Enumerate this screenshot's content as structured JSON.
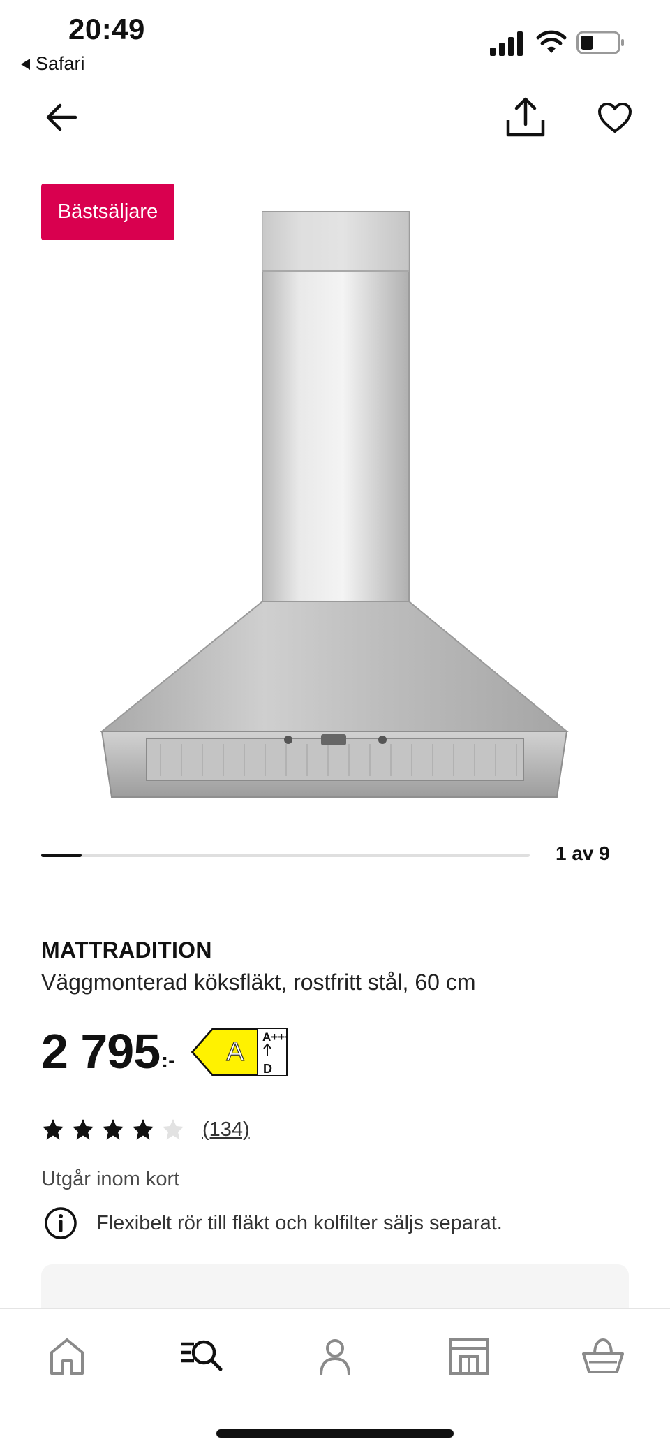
{
  "status_bar": {
    "time": "20:49",
    "back_app": "Safari"
  },
  "badge": {
    "label": "Bästsäljare",
    "color": "#d9004f"
  },
  "gallery": {
    "counter": "1 av 9",
    "progress": 0.083
  },
  "product": {
    "name": "MATTRADITION",
    "description": "Väggmonterad köksfläkt, rostfritt stål, 60 cm",
    "price": "2 795",
    "price_suffix": ":-",
    "energy_class": "A",
    "energy_scale_top": "A+++",
    "energy_scale_bottom": "D",
    "rating": 4,
    "rating_max": 5,
    "review_count": "(134)",
    "availability": "Utgår inom kort",
    "notice": "Flexibelt rör till fläkt och kolfilter säljs separat."
  },
  "icons": {
    "back": "arrow-left-icon",
    "share": "share-icon",
    "favorite": "heart-icon",
    "info": "info-icon",
    "tabs": [
      "home-icon",
      "search-icon",
      "account-icon",
      "store-icon",
      "cart-icon"
    ]
  },
  "colors": {
    "energy_yellow": "#fff200",
    "active_tab": "#111111",
    "inactive_tab": "#8a8a8a"
  }
}
